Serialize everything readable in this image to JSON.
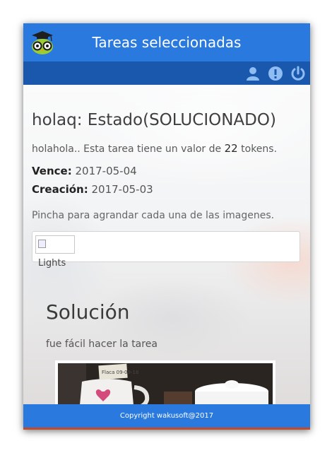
{
  "header": {
    "title": "Tareas seleccionadas",
    "logo_icon": "owl-graduate-icon"
  },
  "toolbar": {
    "icons": [
      "user-icon",
      "alert-icon",
      "power-icon"
    ]
  },
  "task": {
    "title": "holaq: Estado(SOLUCIONADO)",
    "desc_prefix": "holahola.. Esta tarea tiene un valor de",
    "tokens": "22",
    "desc_suffix": "tokens.",
    "due_label": "Vence:",
    "due_value": "2017-05-04",
    "created_label": "Creación:",
    "created_value": "2017-05-03",
    "hint": "Pincha para agrandar cada una de las imagenes.",
    "image_alt": "Lights"
  },
  "solution": {
    "title": "Solución",
    "text": "fue fácil hacer la tarea",
    "photo_caption": "Flaca 09-09-18"
  },
  "footer": {
    "copyright": "Copyright wakusoft@2017"
  },
  "colors": {
    "header": "#2979de",
    "toolbar": "#1a58ad",
    "footer": "#2979de"
  }
}
